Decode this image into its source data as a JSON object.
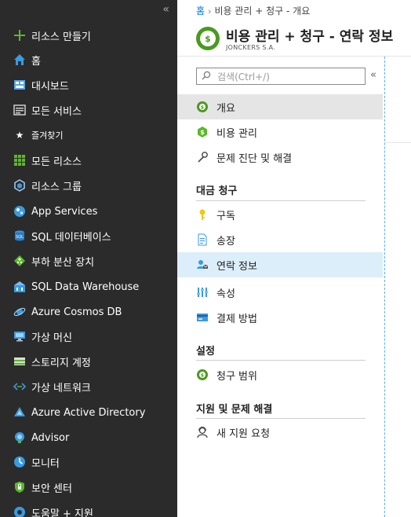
{
  "leftnav": {
    "create_resource": "리소스 만들기",
    "items": [
      {
        "label": "홈",
        "icon": "home-icon"
      },
      {
        "label": "대시보드",
        "icon": "dashboard-icon"
      },
      {
        "label": "모든 서비스",
        "icon": "list-icon"
      }
    ],
    "favorites_label": "즐겨찾기",
    "favorites": [
      {
        "label": "모든 리소스",
        "icon": "grid-icon"
      },
      {
        "label": "리소스 그룹",
        "icon": "resource-group-icon"
      },
      {
        "label": "App Services",
        "icon": "app-services-icon"
      },
      {
        "label": "SQL 데이터베이스",
        "icon": "sql-database-icon"
      },
      {
        "label": "부하 분산 장치",
        "icon": "load-balancer-icon"
      },
      {
        "label": "SQL Data Warehouse",
        "icon": "sql-data-warehouse-icon"
      },
      {
        "label": "Azure Cosmos DB",
        "icon": "cosmos-db-icon"
      },
      {
        "label": "가상 머신",
        "icon": "virtual-machine-icon"
      },
      {
        "label": "스토리지 계정",
        "icon": "storage-account-icon"
      },
      {
        "label": "가상 네트워크",
        "icon": "virtual-network-icon"
      },
      {
        "label": "Azure Active Directory",
        "icon": "active-directory-icon"
      },
      {
        "label": "Advisor",
        "icon": "advisor-icon"
      },
      {
        "label": "모니터",
        "icon": "monitor-icon"
      },
      {
        "label": "보안 센터",
        "icon": "security-center-icon"
      },
      {
        "label": "도움말 + 지원",
        "icon": "help-support-icon"
      }
    ]
  },
  "breadcrumb": {
    "home": "홈",
    "current": "비용 관리 + 청구 - 개요"
  },
  "header": {
    "title": "비용 관리 + 청구  -  연락 정보",
    "subtitle": "JONCKERS S.A."
  },
  "menu": {
    "search_placeholder": "검색(Ctrl+/)",
    "top_items": [
      {
        "label": "개요",
        "icon": "overview-icon"
      },
      {
        "label": "비용 관리",
        "icon": "cost-management-icon"
      },
      {
        "label": "문제 진단 및 해결",
        "icon": "wrench-icon"
      }
    ],
    "billing_section": "대금 청구",
    "billing_items": [
      {
        "label": "구독",
        "icon": "key-icon"
      },
      {
        "label": "송장",
        "icon": "document-icon"
      },
      {
        "label": "연락 정보",
        "icon": "contact-info-icon"
      },
      {
        "label": "속성",
        "icon": "properties-icon"
      },
      {
        "label": "결제 방법",
        "icon": "payment-method-icon"
      }
    ],
    "settings_section": "설정",
    "settings_items": [
      {
        "label": "청구 범위",
        "icon": "billing-scope-icon"
      }
    ],
    "support_section": "지원 및 문제 해결",
    "support_items": [
      {
        "label": "새 지원 요청",
        "icon": "support-request-icon"
      }
    ]
  },
  "colors": {
    "nav_bg": "#2b2b2b",
    "accent": "#0078d4",
    "selected_bg": "#e5e5e5",
    "active_bg": "#ddeefb",
    "brand_green": "#4a9a1d"
  }
}
